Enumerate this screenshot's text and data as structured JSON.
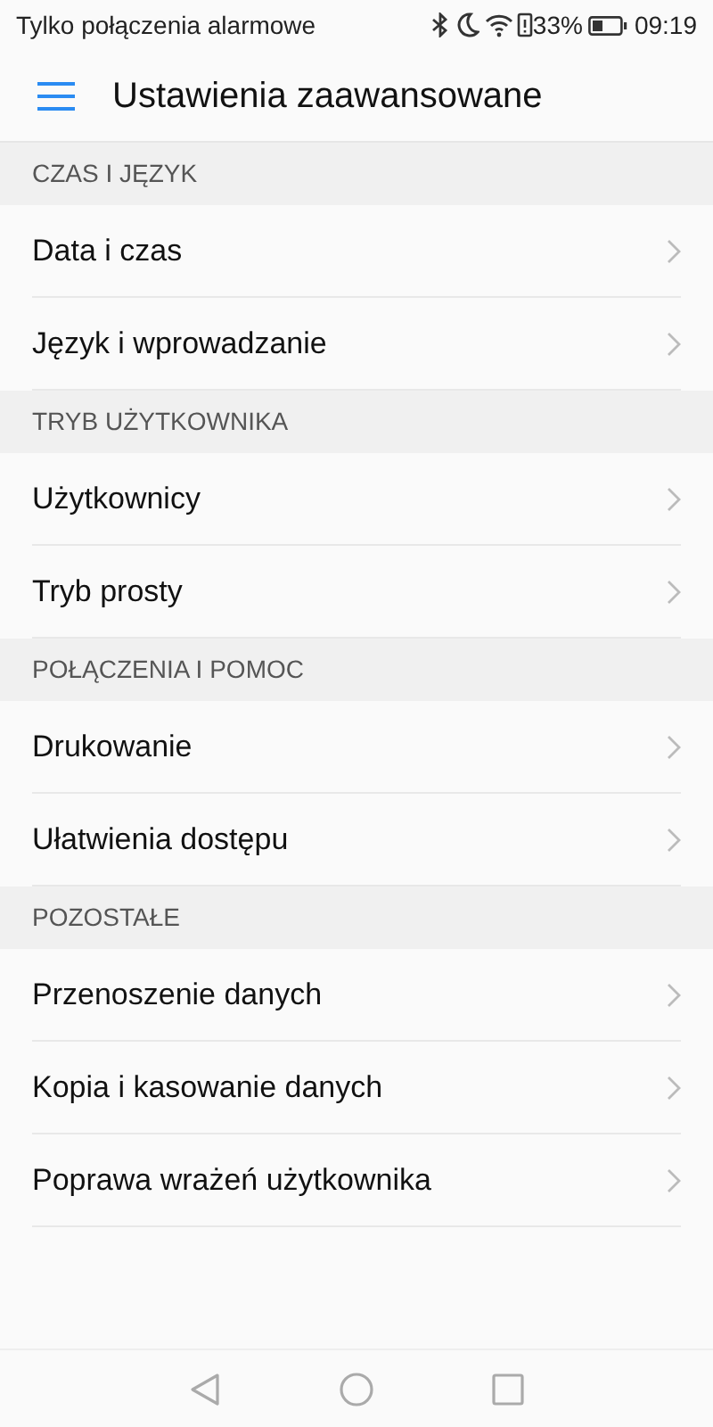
{
  "status_bar": {
    "carrier": "Tylko połączenia alarmowe",
    "battery": "33%",
    "time": "09:19"
  },
  "header": {
    "title": "Ustawienia zaawansowane"
  },
  "sections": [
    {
      "title": "CZAS I JĘZYK",
      "items": [
        "Data i czas",
        "Język i wprowadzanie"
      ]
    },
    {
      "title": "TRYB UŻYTKOWNIKA",
      "items": [
        "Użytkownicy",
        "Tryb prosty"
      ]
    },
    {
      "title": "POŁĄCZENIA I POMOC",
      "items": [
        "Drukowanie",
        "Ułatwienia dostępu"
      ]
    },
    {
      "title": "POZOSTAŁE",
      "items": [
        "Przenoszenie danych",
        "Kopia i kasowanie danych",
        "Poprawa wrażeń użytkownika"
      ]
    }
  ]
}
